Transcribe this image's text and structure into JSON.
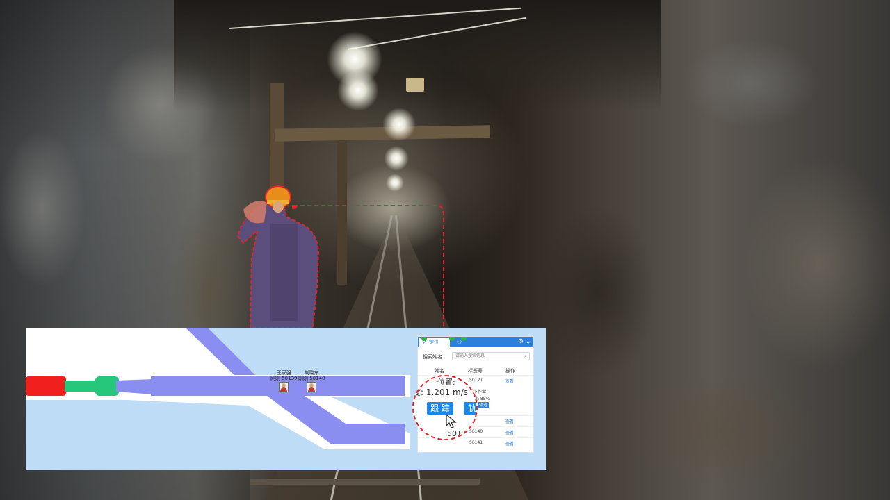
{
  "tabs": [
    {
      "label": "定位",
      "badge": "",
      "icon": "map-pin-icon"
    },
    {
      "label": "",
      "badge": "",
      "icon": "person-icon"
    }
  ],
  "search": {
    "label": "搜索姓名",
    "placeholder": "请输入搜索信息"
  },
  "table": {
    "headers": [
      "姓名",
      "标签号",
      "操作"
    ],
    "rows": [
      {
        "name": "",
        "tag": "50127",
        "action": "查看"
      },
      {
        "name": "",
        "tag": "",
        "action": "查看"
      },
      {
        "name": "",
        "tag": "50140",
        "action": "查看"
      },
      {
        "name": "",
        "tag": "50141",
        "action": "查看"
      }
    ]
  },
  "detail": {
    "location_line": "井下作业",
    "battery_line": "电量: 85%",
    "track_mini": "轨迹"
  },
  "magnifier": {
    "location_text": "位置:",
    "speed_text": "速度: 1.201 m/s",
    "follow_button": "跟 踪",
    "track_button": "轨",
    "tag_text": "50139"
  },
  "map": {
    "workers": [
      {
        "name": "王家强",
        "tag": "刚刚 50139"
      },
      {
        "name": "刘晓东",
        "tag": "刚刚 50140"
      }
    ]
  },
  "colors": {
    "accent": "#2d7fdc",
    "highlight": "#e0262c",
    "tunnel": "#8a8ef0",
    "segment_red": "#f21f1f",
    "segment_green": "#26c77a"
  }
}
